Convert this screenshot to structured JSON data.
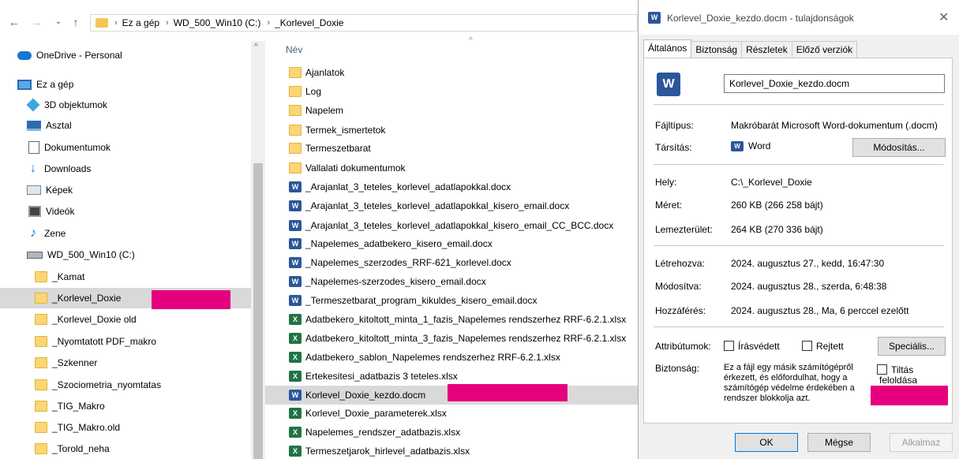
{
  "address": {
    "back": "←",
    "forward": "→",
    "up": "↑",
    "breadcrumb": [
      "Ez a gép",
      "WD_500_Win10 (C:)",
      "_Korlevel_Doxie"
    ]
  },
  "nav": {
    "items": [
      {
        "label": "OneDrive - Personal",
        "icon": "cloud-icon"
      },
      {
        "label": "Ez a gép",
        "icon": "computer-icon"
      },
      {
        "label": "3D objektumok",
        "icon": "cube-icon"
      },
      {
        "label": "Asztal",
        "icon": "desktop-icon"
      },
      {
        "label": "Dokumentumok",
        "icon": "document-icon"
      },
      {
        "label": "Downloads",
        "icon": "download-icon"
      },
      {
        "label": "Képek",
        "icon": "pictures-icon"
      },
      {
        "label": "Videók",
        "icon": "video-icon"
      },
      {
        "label": "Zene",
        "icon": "music-icon"
      },
      {
        "label": "WD_500_Win10 (C:)",
        "icon": "drive-icon"
      },
      {
        "label": "_Kamat",
        "icon": "folder-icon"
      },
      {
        "label": "_Korlevel_Doxie",
        "icon": "folder-icon",
        "selected": true
      },
      {
        "label": "_Korlevel_Doxie old",
        "icon": "folder-icon"
      },
      {
        "label": "_Nyomtatott PDF_makro",
        "icon": "folder-icon"
      },
      {
        "label": "_Szkenner",
        "icon": "folder-icon"
      },
      {
        "label": "_Szociometria_nyomtatas",
        "icon": "folder-icon"
      },
      {
        "label": "_TIG_Makro",
        "icon": "folder-icon"
      },
      {
        "label": "_TIG_Makro.old",
        "icon": "folder-icon"
      },
      {
        "label": "_Torold_neha",
        "icon": "folder-icon"
      }
    ]
  },
  "files": {
    "column_name": "Név",
    "items": [
      {
        "name": "Ajanlatok",
        "type": "folder"
      },
      {
        "name": "Log",
        "type": "folder"
      },
      {
        "name": "Napelem",
        "type": "folder"
      },
      {
        "name": "Termek_ismertetok",
        "type": "folder"
      },
      {
        "name": "Termeszetbarat",
        "type": "folder"
      },
      {
        "name": "Vallalati dokumentumok",
        "type": "folder"
      },
      {
        "name": "_Arajanlat_3_teteles_korlevel_adatlapokkal.docx",
        "type": "word"
      },
      {
        "name": "_Arajanlat_3_teteles_korlevel_adatlapokkal_kisero_email.docx",
        "type": "word"
      },
      {
        "name": "_Arajanlat_3_teteles_korlevel_adatlapokkal_kisero_email_CC_BCC.docx",
        "type": "word"
      },
      {
        "name": "_Napelemes_adatbekero_kisero_email.docx",
        "type": "word"
      },
      {
        "name": "_Napelemes_szerzodes_RRF-621_korlevel.docx",
        "type": "word"
      },
      {
        "name": "_Napelemes-szerzodes_kisero_email.docx",
        "type": "word"
      },
      {
        "name": "_Termeszetbarat_program_kikuldes_kisero_email.docx",
        "type": "word"
      },
      {
        "name": "Adatbekero_kitoltott_minta_1_fazis_Napelemes rendszerhez RRF-6.2.1.xlsx",
        "type": "excel"
      },
      {
        "name": "Adatbekero_kitoltott_minta_3_fazis_Napelemes rendszerhez RRF-6.2.1.xlsx",
        "type": "excel"
      },
      {
        "name": "Adatbekero_sablon_Napelemes rendszerhez RRF-6.2.1.xlsx",
        "type": "excel"
      },
      {
        "name": "Ertekesitesi_adatbazis 3 teteles.xlsx",
        "type": "excel"
      },
      {
        "name": "Korlevel_Doxie_kezdo.docm",
        "type": "wordm",
        "selected": true
      },
      {
        "name": "Korlevel_Doxie_parameterek.xlsx",
        "type": "excel"
      },
      {
        "name": "Napelemes_rendszer_adatbazis.xlsx",
        "type": "excel"
      },
      {
        "name": "Termeszetjarok_hirlevel_adatbazis.xlsx",
        "type": "excel"
      }
    ]
  },
  "dialog": {
    "title": "Korlevel_Doxie_kezdo.docm - tulajdonságok",
    "close": "✕",
    "tabs": [
      "Általános",
      "Biztonság",
      "Részletek",
      "Előző verziók"
    ],
    "filename": "Korlevel_Doxie_kezdo.docm",
    "filetype_label": "Fájltípus:",
    "filetype_value": "Makróbarát Microsoft Word-dokumentum (.docm)",
    "opens_label": "Társítás:",
    "opens_value": "Word",
    "change_button": "Módosítás...",
    "location_label": "Hely:",
    "location_value": "C:\\_Korlevel_Doxie",
    "size_label": "Méret:",
    "size_value": "260 KB (266 258 bájt)",
    "disk_label": "Lemezterület:",
    "disk_value": "264 KB (270 336 bájt)",
    "created_label": "Létrehozva:",
    "created_value": "2024. augusztus 27., kedd, 16:47:30",
    "modified_label": "Módosítva:",
    "modified_value": "2024. augusztus 28., szerda, 6:48:38",
    "accessed_label": "Hozzáférés:",
    "accessed_value": "2024. augusztus 28., Ma, 6 perccel ezelőtt",
    "attributes_label": "Attribútumok:",
    "readonly_label": "Írásvédett",
    "hidden_label": "Rejtett",
    "advanced_button": "Speciális...",
    "security_label": "Biztonság:",
    "security_text": "Ez a fájl egy másik számítógépről érkezett, és előfordulhat, hogy a számítógép védelme érdekében a rendszer blokkolja azt.",
    "unblock_label_1": "Tiltás",
    "unblock_label_2": "feloldása",
    "ok_button": "OK",
    "cancel_button": "Mégse",
    "apply_button": "Alkalmaz"
  },
  "colors": {
    "redaction": "#e5007e",
    "selection": "#d9d9d9",
    "word_blue": "#2b579a",
    "excel_green": "#217346",
    "folder_yellow": "#fcd574"
  }
}
